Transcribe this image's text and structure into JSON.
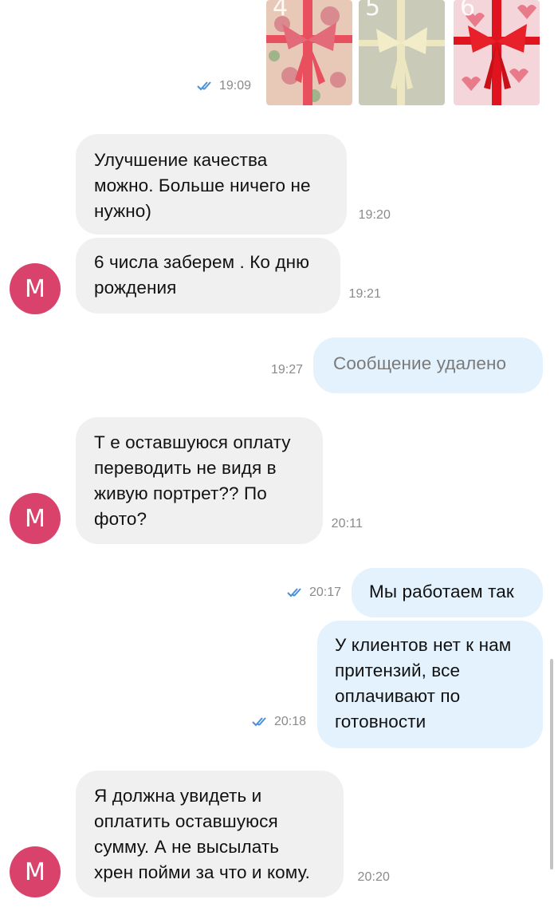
{
  "photos": [
    {
      "number": "4",
      "wrap_color": "#e8c9b8",
      "ribbon_color": "#e8505f"
    },
    {
      "number": "5",
      "wrap_color": "#c9cbb8",
      "ribbon_color": "#ece7c0"
    },
    {
      "number": "6",
      "wrap_color": "#f3d5da",
      "ribbon_color": "#e0141e"
    }
  ],
  "photo_message": {
    "time": "19:09",
    "status": "read"
  },
  "messages": [
    {
      "direction": "in",
      "text": "Улучшение качества\nможно. Больше ничего не\nнужно)",
      "time": "19:20"
    },
    {
      "direction": "in",
      "text": "6 числа заберем . Ко дню\nрождения",
      "time": "19:21",
      "avatar": "M"
    },
    {
      "direction": "out",
      "text": "Сообщение удалено",
      "time": "19:27",
      "deleted": true
    },
    {
      "direction": "in",
      "text": "Т е оставшуюся оплату\nпереводить не видя в\nживую портрет?? По\nфото?",
      "time": "20:11",
      "avatar": "M"
    },
    {
      "direction": "out",
      "text": "Мы работаем так",
      "time": "20:17",
      "status": "read"
    },
    {
      "direction": "out",
      "text": "У клиентов нет к нам\nпритензий, все\nоплачивают по\nготовности",
      "time": "20:18",
      "status": "read"
    },
    {
      "direction": "in",
      "text": "Я должна увидеть  и\nоплатить оставшуюся\nсумму. А не высылать\nхрен пойми за что и кому.",
      "time": "20:20",
      "avatar": "M"
    }
  ],
  "colors": {
    "incoming_bubble": "#f0f0f0",
    "outgoing_bubble": "#e3f2fd",
    "avatar": "#d9426b",
    "tick": "#4a90d9"
  }
}
